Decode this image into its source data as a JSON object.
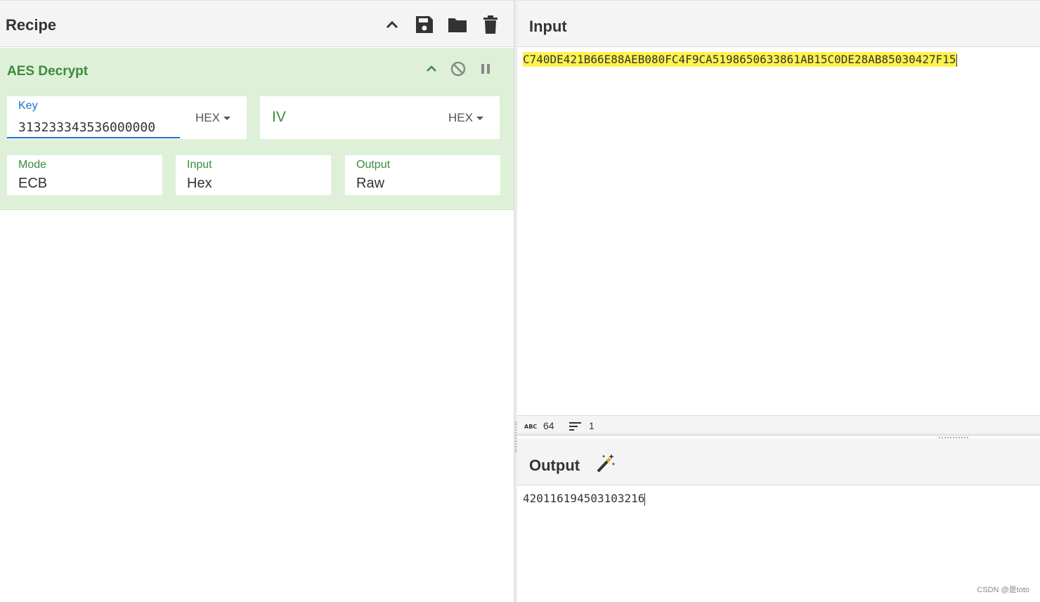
{
  "recipe": {
    "title": "Recipe",
    "buttons": {
      "collapse": "chevron-up-icon",
      "save": "save-icon",
      "load": "folder-icon",
      "clear": "trash-icon"
    }
  },
  "operation": {
    "title": "AES Decrypt",
    "key": {
      "label": "Key",
      "value": "313233343536000000",
      "type": "HEX"
    },
    "iv": {
      "label": "IV",
      "value": "",
      "type": "HEX"
    },
    "mode": {
      "label": "Mode",
      "value": "ECB"
    },
    "input": {
      "label": "Input",
      "value": "Hex"
    },
    "output": {
      "label": "Output",
      "value": "Raw"
    }
  },
  "input_pane": {
    "title": "Input",
    "text": "C740DE421B66E88AEB080FC4F9CA5198650633861AB15C0DE28AB85030427F15",
    "status": {
      "length": "64",
      "lines": "1"
    }
  },
  "output_pane": {
    "title": "Output",
    "text": "420116194503103216"
  },
  "watermark": "CSDN @是toto",
  "colors": {
    "operation_bg": "#dff0d8",
    "accent_green": "#3c8a3c",
    "accent_blue": "#1d6fd1",
    "highlight": "#fff34d"
  }
}
